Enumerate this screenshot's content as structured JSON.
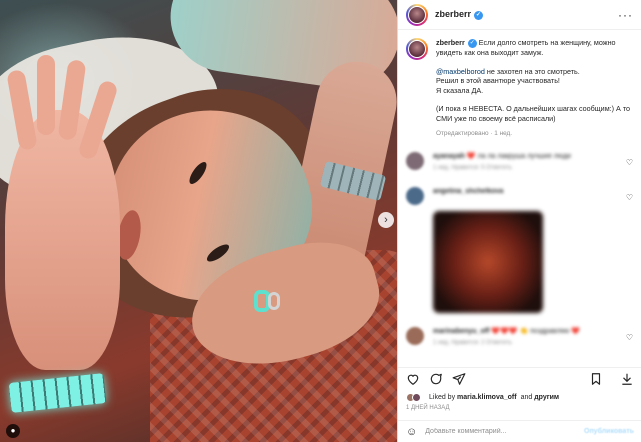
{
  "post": {
    "username": "zberberr",
    "caption": {
      "intro": "Если долго смотреть на женщину, можно увидеть как она выходит замуж.",
      "mention": "@maxbelborod",
      "line2_rest": " не захотел на это смотреть.",
      "line3": "Решил в этой авантюре участвовать!",
      "line4": "Я сказала ДА.",
      "line5": "(И пока я НЕВЕСТА. О дальнейших шагах сообщим:) А то СМИ уже по своему всё расписали)",
      "meta": "Отредактировано · 1 нед."
    },
    "icons": {
      "more": "more-horizontal-icon",
      "next": "chevron-right-icon",
      "tag": "user-tag-icon",
      "verified": "verified-badge-icon"
    }
  },
  "comments": [
    {
      "user": "ayanayah",
      "text": "❤️ ла ла лакруша лучшие люди",
      "meta": "1 нед.  Нравится: 5  Ответить",
      "avatar_color": "#7d6a74"
    },
    {
      "user": "angelina_shchelkova",
      "text": "",
      "meta": "",
      "avatar_color": "#4b6a8a",
      "has_image": true
    },
    {
      "user": "marinabenyu_off",
      "text": "❤️❤️❤️ 👏 поздравляю ❤️",
      "meta": "1 нед.  Нравится: 2  Ответить",
      "avatar_color": "#9a6b58"
    }
  ],
  "likes": {
    "prefix": "Liked by ",
    "user": "maria.klimova_off",
    "joiner": "and ",
    "suffix": "другим"
  },
  "date": "1 ДНЕЙ НАЗАД",
  "add_comment": {
    "placeholder": "Добавьте комментарий...",
    "post": "Опубликовать"
  }
}
